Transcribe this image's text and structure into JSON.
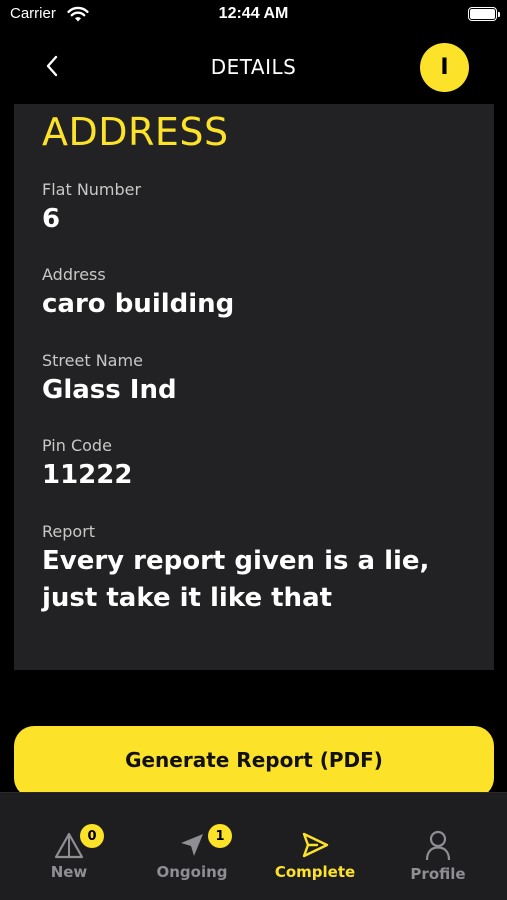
{
  "status_bar": {
    "carrier": "Carrier",
    "time": "12:44 AM"
  },
  "nav": {
    "title": "DETAILS",
    "avatar_initial": "I"
  },
  "card": {
    "title": "ADDRESS",
    "fields": [
      {
        "label": "Flat Number",
        "value": "6"
      },
      {
        "label": "Address",
        "value": "caro building"
      },
      {
        "label": "Street Name",
        "value": "Glass Ind"
      },
      {
        "label": "Pin Code",
        "value": "11222"
      },
      {
        "label": "Report",
        "value": "Every report given is a lie, just take it like that"
      }
    ]
  },
  "generate_button": {
    "label": "Generate Report (PDF)"
  },
  "tabs": [
    {
      "label": "New",
      "icon": "warning-triangle-icon",
      "badge": "0"
    },
    {
      "label": "Ongoing",
      "icon": "navigation-arrow-icon",
      "badge": "1"
    },
    {
      "label": "Complete",
      "icon": "send-paper-plane-icon",
      "active": true
    },
    {
      "label": "Profile",
      "icon": "person-icon"
    }
  ],
  "colors": {
    "accent": "#fde22a",
    "background": "#000000",
    "card": "#222224",
    "tab_bar": "#1e1e20",
    "inactive": "#8e8e93"
  }
}
